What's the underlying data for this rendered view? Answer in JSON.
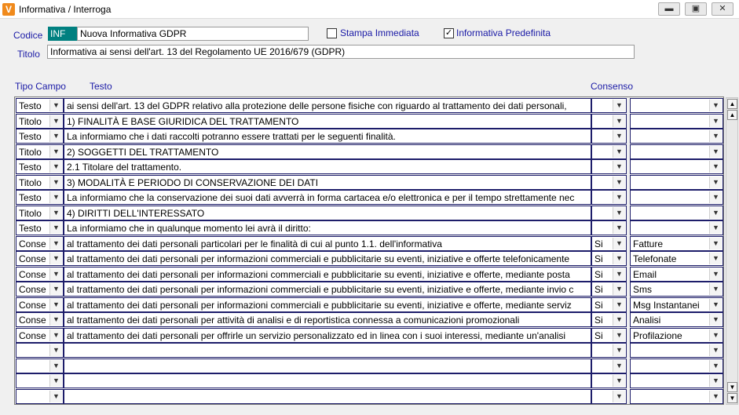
{
  "window": {
    "title": "Informativa / Interroga",
    "app_icon": "V",
    "buttons": {
      "minimize": "▬",
      "maximize": "▣",
      "close": "✕"
    }
  },
  "form": {
    "codice_label": "Codice",
    "codice_code": "INF",
    "codice_name": "Nuova Informativa GDPR",
    "stampa_label": "Stampa Immediata",
    "stampa_checked": false,
    "predefinita_label": "Informativa Predefinita",
    "predefinita_checked": true,
    "titolo_label": "Titolo",
    "titolo_value": "Informativa ai sensi dell'art. 13 del Regolamento UE 2016/679 (GDPR)"
  },
  "grid": {
    "headers": {
      "tipo": "Tipo Campo",
      "testo": "Testo",
      "consenso": "Consenso"
    },
    "rows": [
      {
        "tipo": "Testo",
        "testo": "ai sensi dell'art. 13 del GDPR relativo alla protezione delle persone fisiche con riguardo al trattamento dei dati personali,",
        "consenso": "",
        "categoria": ""
      },
      {
        "tipo": "Titolo",
        "testo": "1)   FINALITÀ E BASE GIURIDICA DEL TRATTAMENTO",
        "consenso": "",
        "categoria": ""
      },
      {
        "tipo": "Testo",
        "testo": "La informiamo che i dati raccolti potranno essere trattati per le seguenti finalità.",
        "consenso": "",
        "categoria": ""
      },
      {
        "tipo": "Titolo",
        "testo": "2)   SOGGETTI DEL TRATTAMENTO",
        "consenso": "",
        "categoria": ""
      },
      {
        "tipo": "Testo",
        "testo": "2.1 Titolare del trattamento.",
        "consenso": "",
        "categoria": ""
      },
      {
        "tipo": "Titolo",
        "testo": "3)   MODALITÀ E PERIODO DI CONSERVAZIONE DEI DATI",
        "consenso": "",
        "categoria": ""
      },
      {
        "tipo": "Testo",
        "testo": "La informiamo che la conservazione dei suoi dati avverrà in forma cartacea e/o elettronica e per il tempo strettamente nec",
        "consenso": "",
        "categoria": ""
      },
      {
        "tipo": "Titolo",
        "testo": "4)   DIRITTI DELL'INTERESSATO",
        "consenso": "",
        "categoria": ""
      },
      {
        "tipo": "Testo",
        "testo": "La informiamo che in qualunque momento lei avrà il diritto:",
        "consenso": "",
        "categoria": ""
      },
      {
        "tipo": "Conse",
        "testo": "al trattamento dei dati personali particolari per le finalità di cui al punto 1.1. dell'informativa",
        "consenso": "Si",
        "categoria": "Fatture"
      },
      {
        "tipo": "Conse",
        "testo": "al trattamento dei dati personali per informazioni commerciali e pubblicitarie su eventi, iniziative e offerte telefonicamente",
        "consenso": "Si",
        "categoria": "Telefonate"
      },
      {
        "tipo": "Conse",
        "testo": "al trattamento dei dati personali per informazioni commerciali e pubblicitarie su eventi, iniziative e offerte, mediante posta",
        "consenso": "Si",
        "categoria": "Email"
      },
      {
        "tipo": "Conse",
        "testo": "al trattamento dei dati personali per informazioni commerciali e pubblicitarie su eventi, iniziative e offerte, mediante invio c",
        "consenso": "Si",
        "categoria": "Sms"
      },
      {
        "tipo": "Conse",
        "testo": "al trattamento dei dati personali per informazioni commerciali e pubblicitarie su eventi, iniziative e offerte, mediante serviz",
        "consenso": "Si",
        "categoria": "Msg Instantanei"
      },
      {
        "tipo": "Conse",
        "testo": "al trattamento dei dati personali per attività di analisi e di reportistica connessa a comunicazioni promozionali",
        "consenso": "Si",
        "categoria": "Analisi"
      },
      {
        "tipo": "Conse",
        "testo": "al trattamento dei dati personali per offrirle un servizio personalizzato ed in linea con i suoi interessi, mediante un'analisi",
        "consenso": "Si",
        "categoria": "Profilazione"
      },
      {
        "tipo": "",
        "testo": "",
        "consenso": "",
        "categoria": ""
      },
      {
        "tipo": "",
        "testo": "",
        "consenso": "",
        "categoria": ""
      },
      {
        "tipo": "",
        "testo": "",
        "consenso": "",
        "categoria": ""
      },
      {
        "tipo": "",
        "testo": "",
        "consenso": "",
        "categoria": ""
      }
    ]
  },
  "icons": {
    "dropdown": "chevron-down-icon",
    "scroll_top": "double-arrow-up-icon",
    "scroll_up": "arrow-up-icon",
    "scroll_down": "arrow-down-icon",
    "scroll_bottom": "double-arrow-down-icon"
  },
  "colors": {
    "label_blue": "#1a1aa6",
    "code_teal": "#008080",
    "app_icon_orange": "#f08a1c"
  }
}
